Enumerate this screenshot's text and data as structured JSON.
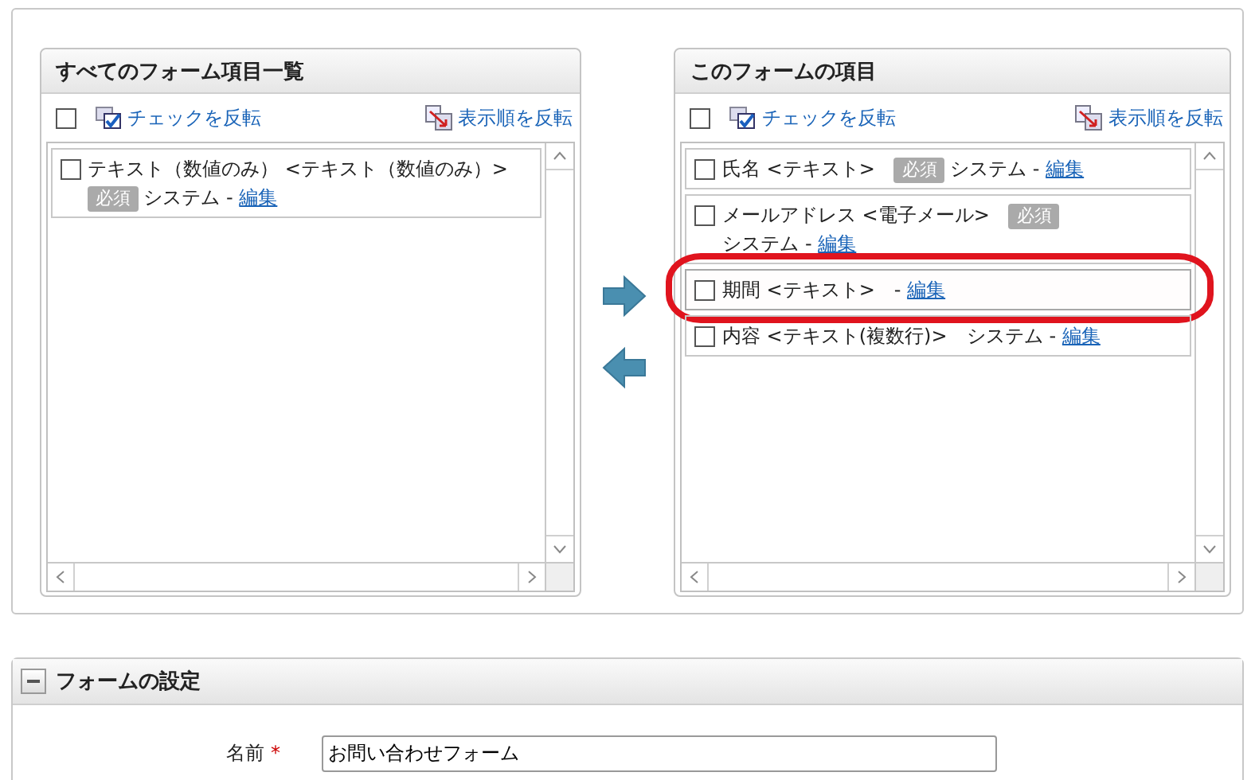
{
  "panels": [
    {
      "title": "すべてのフォーム項目一覧",
      "toggle_check": "チェックを反転",
      "reverse_order": "表示順を反転",
      "all_checked": false,
      "items": [
        {
          "label": "テキスト（数値のみ） <テキスト（数値のみ）>",
          "required": "必須",
          "owner": "システム",
          "separator": "-",
          "edit": "編集",
          "checked": false,
          "annotated": false
        }
      ]
    },
    {
      "title": "このフォームの項目",
      "toggle_check": "チェックを反転",
      "reverse_order": "表示順を反転",
      "all_checked": false,
      "items": [
        {
          "label": "氏名 <テキスト>",
          "required": "必須",
          "owner": "システム",
          "separator": "-",
          "edit": "編集",
          "checked": false,
          "annotated": false
        },
        {
          "label": "メールアドレス <電子メール>",
          "required": "必須",
          "owner": "システム",
          "separator": "-",
          "edit": "編集",
          "checked": false,
          "annotated": false
        },
        {
          "label": "期間 <テキスト>",
          "separator": "-",
          "edit": "編集",
          "checked": false,
          "annotated": true
        },
        {
          "label": "内容 <テキスト(複数行)>",
          "owner": "システム",
          "separator": "-",
          "edit": "編集",
          "checked": false,
          "annotated": false
        }
      ]
    }
  ],
  "settings": {
    "title": "フォームの設定",
    "expanded": true,
    "fields": [
      {
        "label": "名前",
        "required_mark": "*",
        "value": "お問い合わせフォーム"
      }
    ]
  }
}
